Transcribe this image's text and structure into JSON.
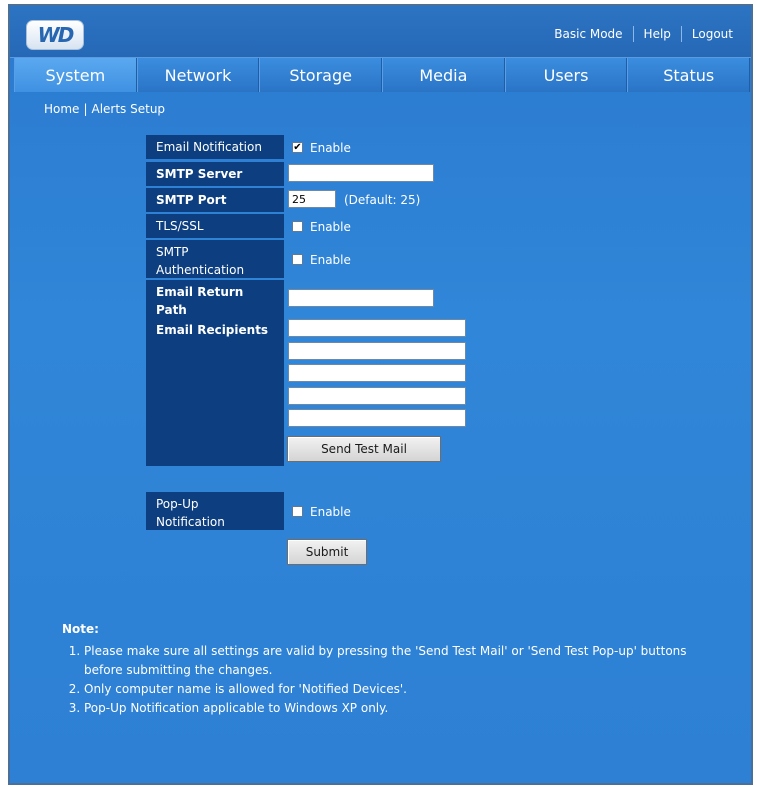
{
  "header": {
    "logo_text": "WD",
    "links": [
      "Basic Mode",
      "Help",
      "Logout"
    ]
  },
  "nav": {
    "tabs": [
      "System",
      "Network",
      "Storage",
      "Media",
      "Users",
      "Status"
    ],
    "active": "System"
  },
  "breadcrumb": [
    "Home",
    "Alerts Setup"
  ],
  "form": {
    "email_notification_label": "Email Notification",
    "email_notification_enable": "Enable",
    "smtp_server_label": "SMTP Server",
    "smtp_server_value": "",
    "smtp_port_label": "SMTP Port",
    "smtp_port_value": "25",
    "smtp_port_hint": "(Default: 25)",
    "tls_label": "TLS/SSL",
    "tls_enable": "Enable",
    "smtp_auth_label_line1": "SMTP",
    "smtp_auth_label_line2": "Authentication",
    "smtp_auth_enable": "Enable",
    "return_path_label_line1": "Email Return",
    "return_path_label_line2": "Path",
    "return_path_value": "",
    "recipients_label": "Email Recipients",
    "recipients": [
      "",
      "",
      "",
      "",
      ""
    ],
    "send_test_label": "Send Test Mail",
    "popup_label_line1": "Pop-Up",
    "popup_label_line2": "Notification",
    "popup_enable": "Enable",
    "submit_label": "Submit",
    "checked": {
      "email_notification": true,
      "tls": false,
      "smtp_auth": false,
      "popup": false
    }
  },
  "note": {
    "title": "Note:",
    "items": [
      "Please make sure all settings are valid by pressing the 'Send Test Mail' or 'Send Test Pop-up' buttons before submitting the changes.",
      "Only computer name is allowed for 'Notified Devices'.",
      "Pop-Up Notification applicable to Windows XP only."
    ]
  },
  "colors": {
    "background": "#2f7fd2",
    "label_bg": "#0d3f80",
    "active_tab": "#4a9be8"
  }
}
